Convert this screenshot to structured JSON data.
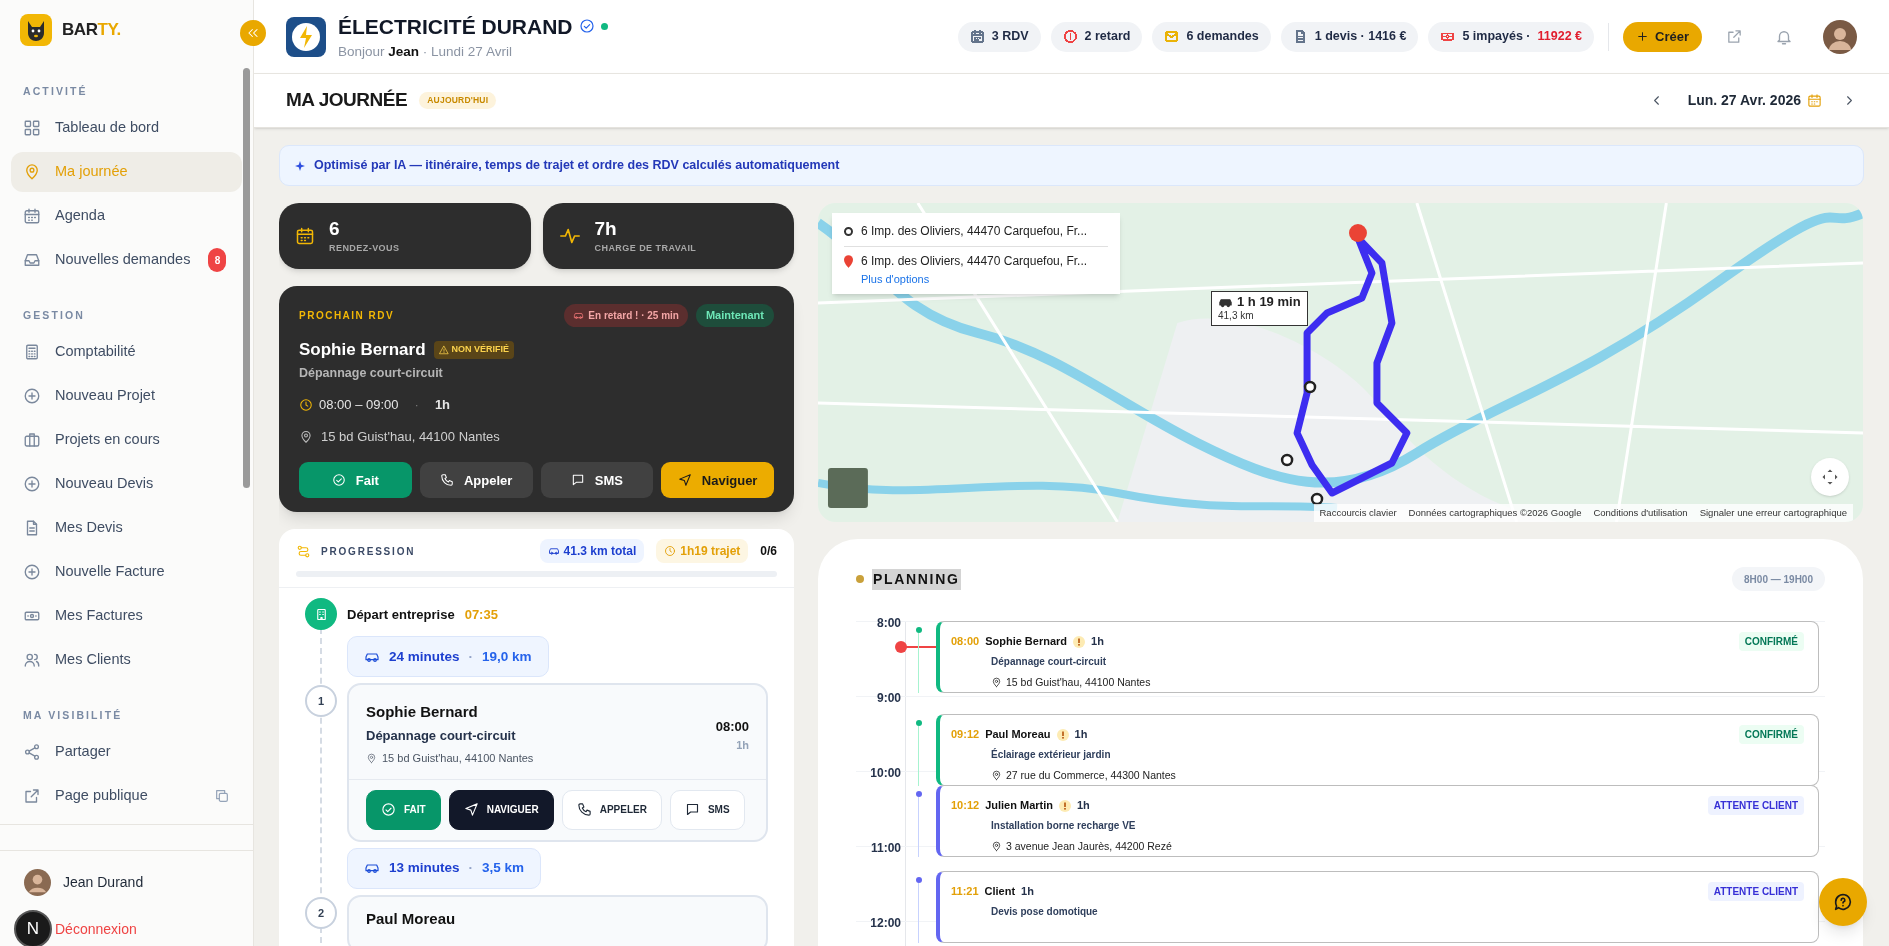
{
  "brand": {
    "name_main": "BAR",
    "name_accent": "TY."
  },
  "sidebar": {
    "sections": [
      {
        "title": "ACTIVITÉ",
        "items": [
          {
            "label": "Tableau de bord",
            "selected": false
          },
          {
            "label": "Ma journée",
            "selected": true
          },
          {
            "label": "Agenda",
            "selected": false
          },
          {
            "label": "Nouvelles demandes",
            "selected": false,
            "badge": "8"
          }
        ]
      },
      {
        "title": "GESTION",
        "items": [
          {
            "label": "Comptabilité",
            "selected": false
          },
          {
            "label": "Nouveau Projet",
            "selected": false
          },
          {
            "label": "Projets en cours",
            "selected": false
          },
          {
            "label": "Nouveau Devis",
            "selected": false
          },
          {
            "label": "Mes Devis",
            "selected": false
          },
          {
            "label": "Nouvelle Facture",
            "selected": false
          },
          {
            "label": "Mes Factures",
            "selected": false
          },
          {
            "label": "Mes Clients",
            "selected": false
          }
        ]
      },
      {
        "title": "MA VISIBILITÉ",
        "items": [
          {
            "label": "Partager",
            "selected": false
          },
          {
            "label": "Page publique",
            "selected": false,
            "copy_button": true
          }
        ]
      }
    ],
    "user": {
      "name": "Jean Durand",
      "logout": "Déconnexion"
    },
    "dev_badge": "N"
  },
  "header": {
    "company": "ÉLECTRICITÉ DURAND",
    "verified": true,
    "online": true,
    "greeting": "Bonjour **Jean** · Lundi 27 Avril",
    "pills": [
      {
        "label": "3 RDV",
        "color": "#64748b"
      },
      {
        "label": "2 retard",
        "color": "#ef4444"
      },
      {
        "label": "6 demandes",
        "color": "#eab308"
      },
      {
        "label": "1 devis · 1416 €",
        "color": "#64748b"
      },
      {
        "label": "5 impayés · ",
        "amount": "11922 €",
        "color": "#ef4444"
      }
    ],
    "create_button": "Créer"
  },
  "page": {
    "title": "MA JOURNÉE",
    "badge": "AUJOURD'HUI",
    "date": "Lun. 27 Avr. 2026"
  },
  "ai_banner": "Optimisé par IA — itinéraire, temps de trajet et ordre des RDV calculés automatiquement",
  "stats": [
    {
      "value": "6",
      "label": "RENDEZ-VOUS"
    },
    {
      "value": "7h",
      "label": "CHARGE DE TRAVAIL"
    }
  ],
  "next_rdv": {
    "heading": "PROCHAIN RDV",
    "late_badge": "En retard ! · 25 min",
    "now_badge": "Maintenant",
    "client": "Sophie Bernard",
    "verification_badge": "NON VÉRIFIÉ",
    "service": "Dépannage court-circuit",
    "time": "08:00 – 09:00",
    "separator": "·",
    "duration": "1h",
    "address": "15 bd Guist'hau, 44100 Nantes",
    "actions": [
      {
        "label": "Fait",
        "kind": "done"
      },
      {
        "label": "Appeler",
        "kind": "call"
      },
      {
        "label": "SMS",
        "kind": "sms"
      },
      {
        "label": "Naviguer",
        "kind": "navigate"
      }
    ]
  },
  "progression": {
    "title": "PROGRESSION",
    "distance": "41.3 km total",
    "travel": "1h19 trajet",
    "count": "0/6",
    "steps": [
      {
        "kind": "start",
        "label": "Départ entreprise",
        "time": "07:35"
      },
      {
        "kind": "travel",
        "duration": "24 minutes",
        "separator": "·",
        "distance": "19,0 km"
      },
      {
        "kind": "stop",
        "number": "1",
        "client": "Sophie Bernard",
        "service": "Dépannage court-circuit",
        "address": "15 bd Guist'hau, 44100 Nantes",
        "time": "08:00",
        "duration": "1h",
        "actions": [
          {
            "label": "FAIT",
            "kind": "done"
          },
          {
            "label": "NAVIGUER",
            "kind": "navigate"
          },
          {
            "label": "APPELER",
            "kind": "call"
          },
          {
            "label": "SMS",
            "kind": "sms"
          }
        ]
      },
      {
        "kind": "travel",
        "duration": "13 minutes",
        "separator": "·",
        "distance": "3,5 km"
      },
      {
        "kind": "stop",
        "number": "2",
        "client": "Paul Moreau"
      }
    ]
  },
  "map": {
    "route_from": "6 Imp. des Oliviers, 44470 Carquefou, Fr...",
    "route_to": "6 Imp. des Oliviers, 44470 Carquefou, Fr...",
    "more_options": "Plus d'options",
    "duration": "1 h 19 min",
    "distance": "41,3 km",
    "footer": [
      "Raccourcis clavier",
      "Données cartographiques ©2026 Google",
      "Conditions d'utilisation",
      "Signaler une erreur cartographique"
    ]
  },
  "planning": {
    "title": "PLANNING",
    "range": "8H00 — 19H00",
    "hours": [
      "8:00",
      "9:00",
      "10:00",
      "11:00",
      "12:00"
    ],
    "events": [
      {
        "time": "08:00",
        "client": "Sophie Bernard",
        "warning": true,
        "duration": "1h",
        "service": "Dépannage court-circuit",
        "address": "15 bd Guist'hau, 44100 Nantes",
        "status": "CONFIRMÉ",
        "kind": "confirmed"
      },
      {
        "time": "09:12",
        "client": "Paul Moreau",
        "warning": true,
        "duration": "1h",
        "service": "Éclairage extérieur jardin",
        "address": "27 rue du Commerce, 44300 Nantes",
        "status": "CONFIRMÉ",
        "kind": "confirmed"
      },
      {
        "time": "10:12",
        "client": "Julien Martin",
        "warning": true,
        "duration": "1h",
        "service": "Installation borne recharge VE",
        "address": "3 avenue Jean Jaurès, 44200 Rezé",
        "status": "ATTENTE CLIENT",
        "kind": "waiting"
      },
      {
        "time": "11:21",
        "client": "Client",
        "warning": false,
        "duration": "1h",
        "service": "Devis pose domotique",
        "status": "ATTENTE CLIENT",
        "kind": "waiting"
      }
    ]
  }
}
